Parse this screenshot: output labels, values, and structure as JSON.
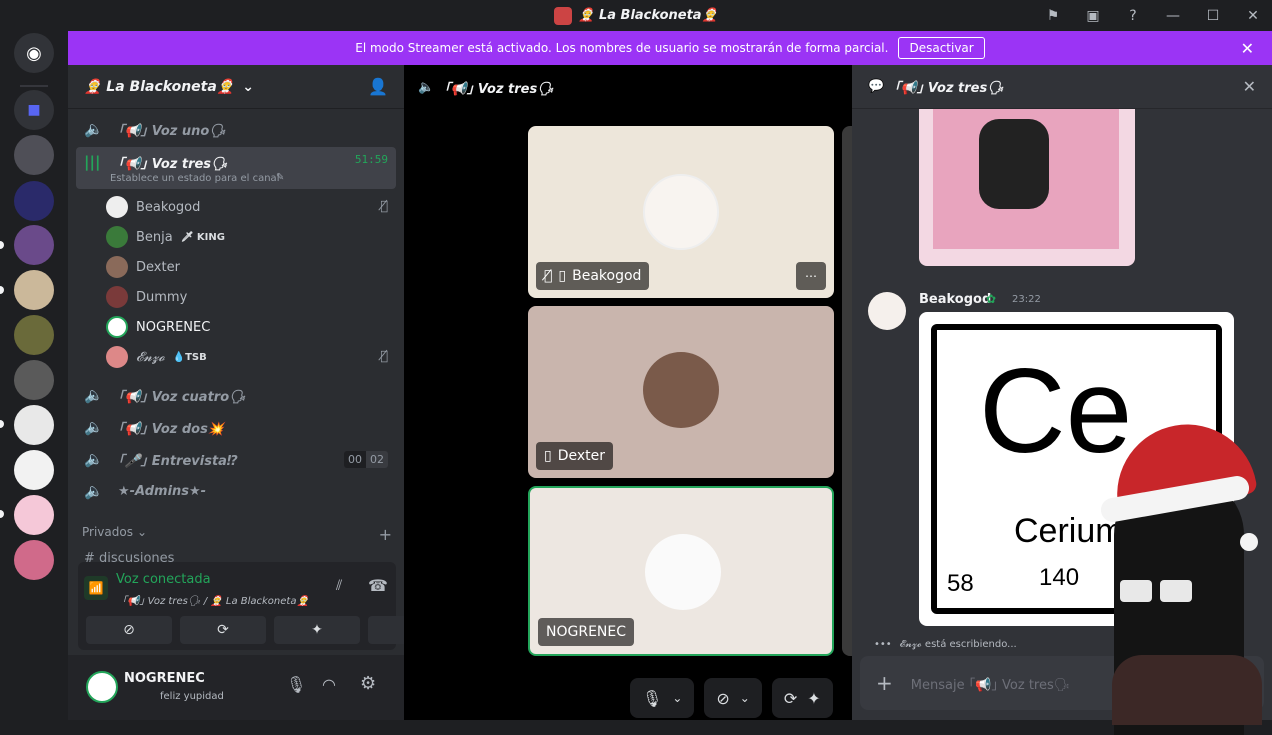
{
  "window": {
    "title": "🤶 La Blackoneta🤶"
  },
  "banner": {
    "text": "El modo Streamer está activado. Los nombres de usuario se mostrarán de forma parcial.",
    "button": "Desactivar"
  },
  "server": {
    "name": "🤶 La Blackoneta🤶"
  },
  "channels": {
    "voz_uno": "｢📢｣ Voz uno🗣",
    "voz_tres": "｢📢｣ Voz tres🗣",
    "voz_tres_timer": "51:59",
    "voz_tres_status": "Establece un estado para el canal",
    "voz_cuatro": "｢📢｣ Voz cuatro🗣",
    "voz_dos": "｢📢｣ Voz dos💥",
    "entrevista": "｢🎤｣ Entrevista⁉",
    "entrevista_count_a": "00",
    "entrevista_count_b": "02",
    "admins": "★-Admins★-",
    "privados": "Privados",
    "discusiones": "discusiones"
  },
  "voice_users": [
    {
      "name": "Beakogod",
      "tag": ""
    },
    {
      "name": "Benja",
      "tag": "🗡 KING"
    },
    {
      "name": "Dexter",
      "tag": ""
    },
    {
      "name": "Dummy",
      "tag": ""
    },
    {
      "name": "NOGRENEC",
      "tag": ""
    },
    {
      "name": "𝓔𝓷𝔃𝓸",
      "tag": "💧TSB"
    }
  ],
  "voice_panel": {
    "status": "Voz conectada",
    "location": "｢📢｣ Voz tres🗣 / 🤶 La Blackoneta🤶"
  },
  "user": {
    "name": "NOGRENEC",
    "status": "feliz yupidad"
  },
  "stage": {
    "channel": "｢📢｣ Voz tres🗣",
    "tiles": [
      {
        "label": "Beakogod"
      },
      {
        "label": "Dexter"
      },
      {
        "label": "NOGRENEC"
      }
    ]
  },
  "chat": {
    "channel": "｢📢｣ Voz tres🗣",
    "author": "Beakogod",
    "time": "23:22",
    "element_symbol": "Ce",
    "element_name": "Cerium",
    "element_number": "58",
    "element_mass": "140",
    "typing": "𝓔𝓷𝔃𝓸 está escribiendo...",
    "placeholder": "Mensaje ｢📢｣ Voz tres🗣"
  },
  "colors": {
    "accent": "#9b34f5",
    "green": "#23a55a",
    "bg": "#1e1f22"
  }
}
